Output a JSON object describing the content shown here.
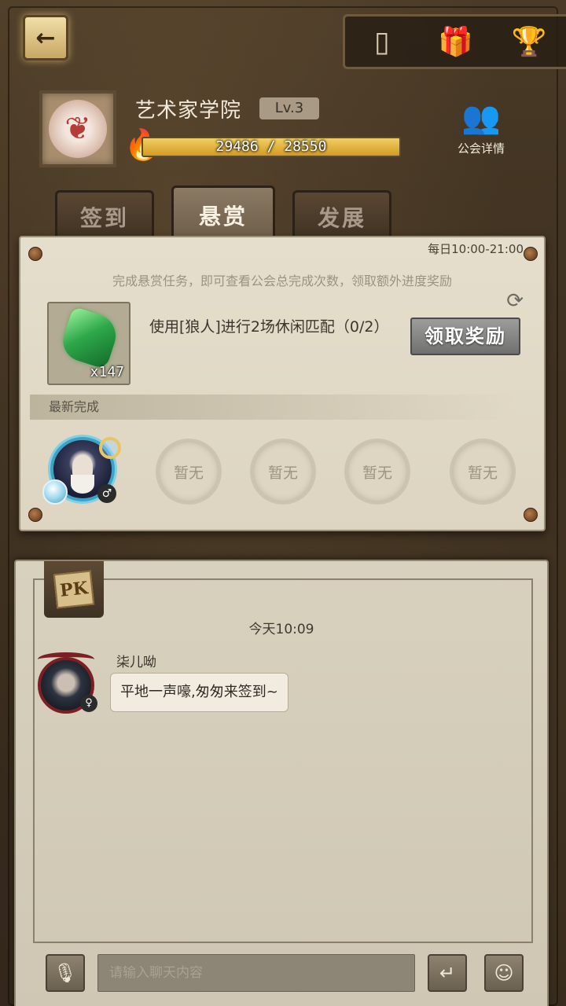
{
  "header": {
    "back_icon": "back-arrow-icon",
    "top_icons": [
      "card-icon",
      "gift-icon",
      "trophy-icon"
    ]
  },
  "guild": {
    "name": "艺术家学院",
    "level": "Lv.3",
    "xp_text": "29486 / 28550",
    "xp_progress": 1.0,
    "detail_label": "公会详情"
  },
  "tabs": [
    {
      "label": "签到",
      "active": false
    },
    {
      "label": "悬赏",
      "active": true
    },
    {
      "label": "发展",
      "active": false
    }
  ],
  "bounty": {
    "time_window": "每日10:00-21:00",
    "description": "完成悬赏任务，即可查看公会总完成次数，领取额外进度奖励",
    "reward_count": "x147",
    "task_text": "使用[狼人]进行2场休闲匹配（0/2）",
    "claim_label": "领取奖励",
    "recent_label": "最新完成",
    "empty_slots": [
      "暂无",
      "暂无",
      "暂无",
      "暂无"
    ]
  },
  "chat": {
    "channel_tag": "PK",
    "timestamp": "今天10:09",
    "messages": [
      {
        "sender": "柒儿呦",
        "text": "平地一声嚎,匆匆来签到~"
      }
    ],
    "input_placeholder": "请输入聊天内容"
  }
}
